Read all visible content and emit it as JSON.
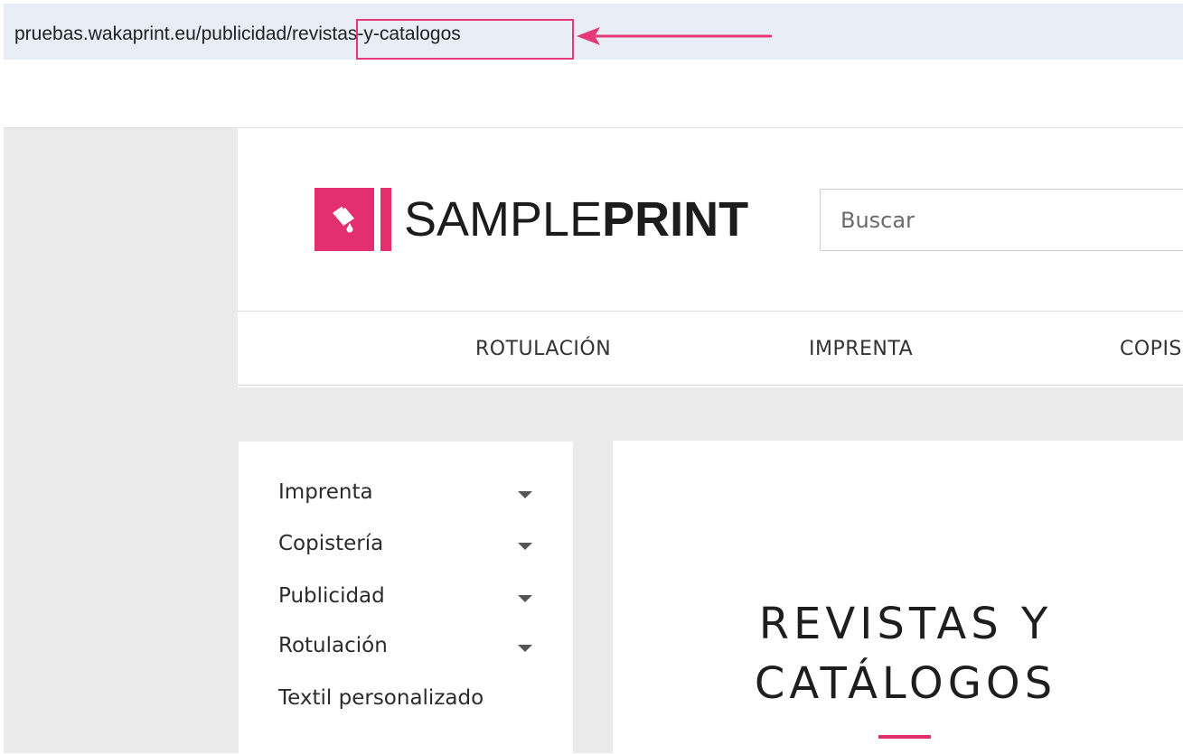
{
  "browser": {
    "url": "pruebas.wakaprint.eu/publicidad/revistas-y-catalogos"
  },
  "header": {
    "logo_light": "SAMPLE",
    "logo_bold": "PRINT",
    "search_placeholder": "Buscar"
  },
  "nav": {
    "items": [
      "ROTULACIÓN",
      "IMPRENTA",
      "COPIS"
    ]
  },
  "sidebar": {
    "items": [
      {
        "label": "Imprenta"
      },
      {
        "label": "Copistería"
      },
      {
        "label": "Publicidad"
      },
      {
        "label": "Rotulación"
      },
      {
        "label": "Textil personalizado"
      }
    ]
  },
  "content": {
    "title_line1": "REVISTAS Y",
    "title_line2": "CATÁLOGOS"
  },
  "colors": {
    "accent": "#e42f6f",
    "highlight": "#e5397a"
  }
}
